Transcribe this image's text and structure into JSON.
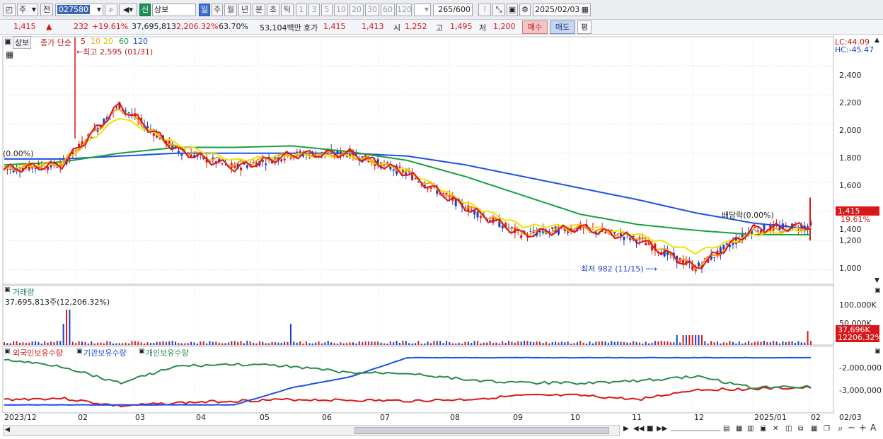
{
  "toolbar": {
    "type_label": "주",
    "prev_label": "전",
    "code": "027580",
    "new_badge": "신",
    "name": "상보",
    "periods": [
      "일",
      "주",
      "월",
      "년",
      "분",
      "초",
      "틱"
    ],
    "intervals": [
      "1",
      "3",
      "5",
      "10",
      "20",
      "30",
      "60",
      "120"
    ],
    "count": "265",
    "count_max": "/600",
    "date": "2025/02/03"
  },
  "quote": {
    "price": "1,415",
    "change": "232",
    "change_pct": "+19.61%",
    "volume": "37,695,813",
    "volume_pct": "2,206.32%",
    "turnover": "63.70%",
    "amount": "53,104백만",
    "bid_label": "호가",
    "bid1": "1,415",
    "bid2": "1,413",
    "open_label": "시",
    "open": "1,252",
    "high_label": "고",
    "high": "1,495",
    "low_label": "저",
    "low": "1,200",
    "buy": "매수",
    "sell": "매도",
    "eval": "평"
  },
  "price_panel": {
    "name": "상보",
    "ma_label": "종가 단순",
    "ma_periods": [
      "5",
      "10",
      "20",
      "60",
      "120"
    ],
    "ma_colors": [
      "#d81818",
      "#f0a020",
      "#f4e000",
      "#18a040",
      "#2050e0"
    ],
    "high_note": "최고 2,595 (01/31)",
    "low_note": "최저 982 (11/15)",
    "left_pct": "(0.00%)",
    "ex_div_note": "배당락(0.00%)",
    "lc": "LC:44.09",
    "hc": "HC:-45.47",
    "price_tag": "1,415",
    "pct_tag": "19.61%",
    "y_ticks": [
      "2,400",
      "2,200",
      "2,000",
      "1,800",
      "1,600",
      "1,400",
      "1,200",
      "1,000"
    ]
  },
  "volume_panel": {
    "title": "거래량",
    "value": "37,695,813주(12,206.32%)",
    "y_ticks": [
      "100,000K",
      "50,000K"
    ],
    "tag1": "37,696K",
    "tag2": "12206.32%"
  },
  "holding_panel": {
    "series": [
      "외국인보유수량",
      "기관보유수량",
      "개인보유수량"
    ],
    "series_colors": [
      "#d81818",
      "#2050e0",
      "#2a8a50"
    ],
    "y_ticks": [
      "-2,000,000",
      "-3,000,000"
    ]
  },
  "x_axis": {
    "labels": [
      "2023/12",
      "02",
      "03",
      "04",
      "05",
      "06",
      "07",
      "08",
      "09",
      "10",
      "11",
      "12",
      "2025/01",
      "02"
    ],
    "right_label": "02/03"
  },
  "chart_data": {
    "type": "line",
    "x": [
      "2023/12",
      "2024/01",
      "2024/02",
      "2024/03",
      "2024/04",
      "2024/05",
      "2024/06",
      "2024/07",
      "2024/08",
      "2024/09",
      "2024/10",
      "2024/11",
      "2024/12",
      "2025/01",
      "2025/02"
    ],
    "series": [
      {
        "name": "5",
        "values": [
          1690,
          1720,
          2130,
          1820,
          1700,
          1790,
          1800,
          1660,
          1430,
          1240,
          1290,
          1210,
          1010,
          1280,
          1300
        ]
      },
      {
        "name": "10",
        "values": [
          1690,
          1730,
          2110,
          1830,
          1720,
          1790,
          1790,
          1670,
          1440,
          1250,
          1290,
          1220,
          1020,
          1260,
          1290
        ]
      },
      {
        "name": "20",
        "values": [
          1700,
          1730,
          2050,
          1860,
          1750,
          1790,
          1780,
          1680,
          1460,
          1300,
          1300,
          1240,
          1120,
          1240,
          1280
        ]
      },
      {
        "name": "60",
        "values": [
          1720,
          1740,
          1800,
          1840,
          1840,
          1850,
          1810,
          1750,
          1640,
          1510,
          1380,
          1310,
          1270,
          1240,
          1240
        ]
      },
      {
        "name": "120",
        "values": [
          1760,
          1760,
          1780,
          1800,
          1800,
          1800,
          1800,
          1780,
          1720,
          1640,
          1560,
          1480,
          1390,
          1320,
          1280
        ]
      }
    ],
    "ylim": [
      900,
      2600
    ],
    "annotations": [
      "최고 2,595 (01/31)",
      "최저 982 (11/15)"
    ]
  }
}
